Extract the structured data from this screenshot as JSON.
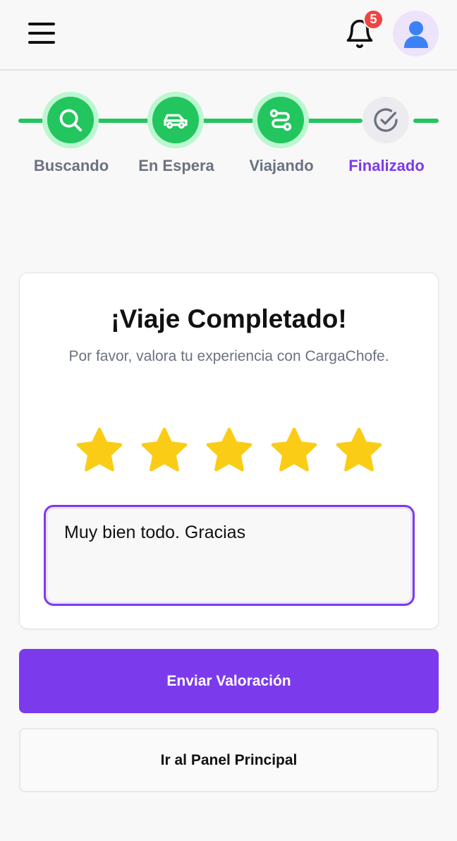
{
  "header": {
    "notification_count": "5",
    "icons": {
      "menu": "menu-icon",
      "bell": "bell-icon",
      "avatar": "user-icon"
    }
  },
  "stepper": {
    "steps": [
      {
        "label": "Buscando",
        "icon": "search-icon",
        "status": "done"
      },
      {
        "label": "En Espera",
        "icon": "car-icon",
        "status": "done"
      },
      {
        "label": "Viajando",
        "icon": "route-icon",
        "status": "done"
      },
      {
        "label": "Finalizado",
        "icon": "check-circle-icon",
        "status": "current"
      }
    ],
    "colors": {
      "done": "#22c55e",
      "active_label": "#7c3aed",
      "inactive_label": "#6b7280"
    }
  },
  "rating_card": {
    "title": "¡Viaje Completado!",
    "subtitle": "Por favor, valora tu experiencia con CargaChofe.",
    "rating": 5,
    "max_rating": 5,
    "comment": "Muy bien todo. Gracias"
  },
  "actions": {
    "submit_label": "Enviar Valoración",
    "dashboard_label": "Ir al Panel Principal"
  },
  "colors": {
    "accent": "#7c3aed",
    "star": "#facc15",
    "success": "#22c55e",
    "badge": "#ef4444"
  }
}
